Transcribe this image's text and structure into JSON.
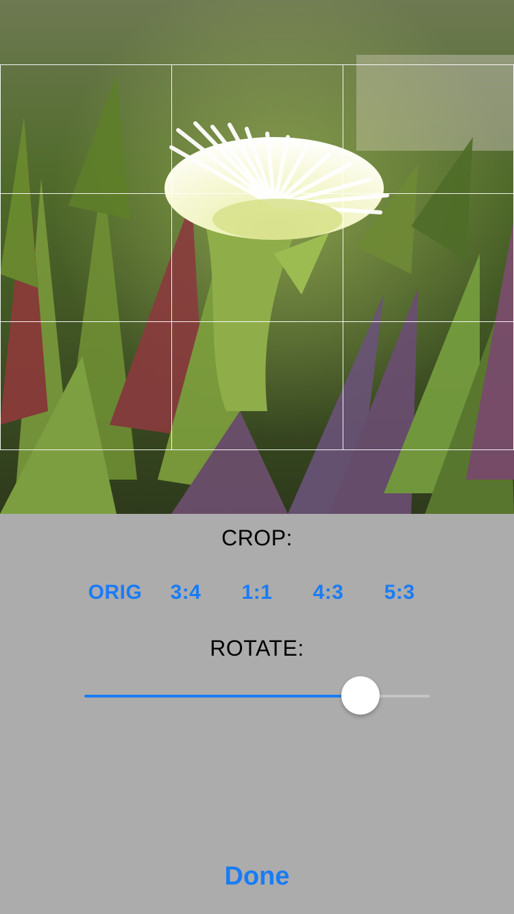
{
  "crop": {
    "label": "CROP:",
    "options": [
      "ORIG",
      "3:4",
      "1:1",
      "4:3",
      "5:3"
    ]
  },
  "rotate": {
    "label": "ROTATE:",
    "value": 0.8
  },
  "done_label": "Done",
  "colors": {
    "accent": "#1a7cf5",
    "panel_background": "#acacac",
    "track": "#c4c4c4"
  }
}
